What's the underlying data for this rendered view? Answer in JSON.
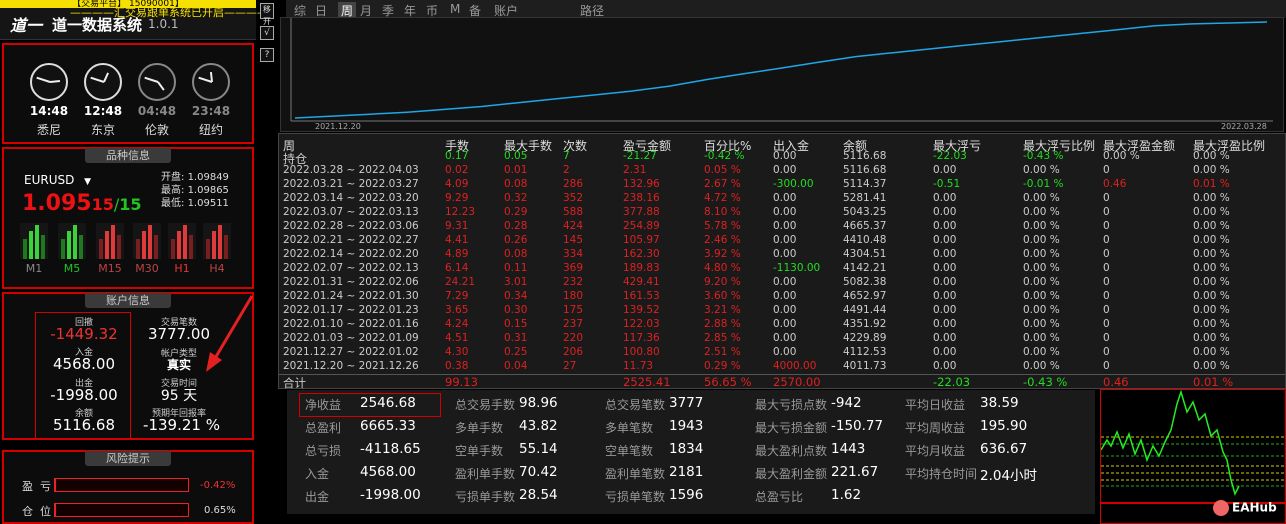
{
  "top_banner": "【交易平台】 15090001】",
  "marquee": "————汇交易跟单系统已开启————",
  "app": {
    "logo": "道一",
    "name": "道一数据系统",
    "version": "1.0.1"
  },
  "clocks": [
    {
      "time": "14:48",
      "name": "悉尼",
      "active": true
    },
    {
      "time": "12:48",
      "name": "东京",
      "active": true
    },
    {
      "time": "04:48",
      "name": "伦敦",
      "active": false
    },
    {
      "time": "23:48",
      "name": "纽约",
      "active": false
    }
  ],
  "symbol_panel": {
    "title": "品种信息",
    "symbol": "EURUSD",
    "price_main": "1.095",
    "price_mid": "15",
    "price_sep": "/",
    "price_last": "15",
    "open_label": "开盘:",
    "open": "1.09849",
    "high_label": "最高:",
    "high": "1.09865",
    "low_label": "最低:",
    "low": "1.09511",
    "timeframes": [
      "M1",
      "M5",
      "M15",
      "M30",
      "H1",
      "H4"
    ]
  },
  "account_panel": {
    "title": "账户信息",
    "drawdown_label": "回撤",
    "drawdown": "-1449.32",
    "deposit_label": "入金",
    "deposit": "4568.00",
    "withdraw_label": "出金",
    "withdraw": "-1998.00",
    "balance_label": "余额",
    "balance": "5116.68",
    "trades_label": "交易笔数",
    "trades": "3777.00",
    "acct_type_label": "帐户类型",
    "acct_type": "真实",
    "time_label": "交易时间",
    "time": "95 天",
    "yield_label": "预期年回报率",
    "yield": "-139.21 %"
  },
  "risk_panel": {
    "title": "风险提示",
    "profit_label": "盈  亏",
    "profit_value": "-0.42%",
    "position_label": "仓  位",
    "position_value": "0.65%"
  },
  "side_buttons": [
    "移开",
    "√",
    "?"
  ],
  "tabs": [
    "综",
    "日",
    "周",
    "月",
    "季",
    "年",
    "币",
    "M",
    "备",
    "账户",
    "路径"
  ],
  "active_tab": "周",
  "chart_data": {
    "type": "line",
    "x_start_label": "2021.12.20",
    "x_end_label": "2022.03.28",
    "color": "#1ea7e8",
    "values": [
      0.0,
      0.02,
      0.04,
      0.06,
      0.09,
      0.12,
      0.16,
      0.2,
      0.24,
      0.28,
      0.33,
      0.4,
      0.46,
      0.52,
      0.58,
      0.64,
      0.68,
      0.72,
      0.76,
      0.8,
      0.84,
      0.88,
      0.92,
      0.96,
      0.98,
      0.99,
      1.0
    ]
  },
  "table": {
    "headers": [
      "周",
      "手数",
      "最大手数",
      "次数",
      "盈亏金额",
      "百分比%",
      "出入金",
      "余额",
      "最大浮亏",
      "最大浮亏比例",
      "最大浮盈金额",
      "最大浮盈比例"
    ],
    "rows": [
      {
        "c": [
          "持仓",
          "0.17",
          "0.05",
          "7",
          "-21.27",
          "-0.42 %",
          "0.00",
          "5116.68",
          "-22.03",
          "-0.43 %",
          "0.00 %",
          "0.00 %"
        ],
        "cls": [
          "w",
          "g",
          "g",
          "g",
          "g",
          "g",
          "w",
          "w",
          "g",
          "g",
          "w",
          "w"
        ]
      },
      {
        "c": [
          "2022.03.28 ~ 2022.04.03",
          "0.02",
          "0.01",
          "2",
          "2.31",
          "0.05 %",
          "0.00",
          "5116.68",
          "0.00",
          "0.00 %",
          "0",
          "0.00 %"
        ],
        "cls": [
          "w",
          "r",
          "r",
          "r",
          "r",
          "r",
          "w",
          "w",
          "w",
          "w",
          "w",
          "w"
        ]
      },
      {
        "c": [
          "2022.03.21 ~ 2022.03.27",
          "4.09",
          "0.08",
          "286",
          "132.96",
          "2.67 %",
          "-300.00",
          "5114.37",
          "-0.51",
          "-0.01 %",
          "0.46",
          "0.01 %"
        ],
        "cls": [
          "w",
          "r",
          "r",
          "r",
          "r",
          "r",
          "g",
          "w",
          "g",
          "g",
          "r",
          "r"
        ]
      },
      {
        "c": [
          "2022.03.14 ~ 2022.03.20",
          "9.29",
          "0.32",
          "352",
          "238.16",
          "4.72 %",
          "0.00",
          "5281.41",
          "0.00",
          "0.00 %",
          "0",
          "0.00 %"
        ],
        "cls": [
          "w",
          "r",
          "r",
          "r",
          "r",
          "r",
          "w",
          "w",
          "w",
          "w",
          "w",
          "w"
        ]
      },
      {
        "c": [
          "2022.03.07 ~ 2022.03.13",
          "12.23",
          "0.29",
          "588",
          "377.88",
          "8.10 %",
          "0.00",
          "5043.25",
          "0.00",
          "0.00 %",
          "0",
          "0.00 %"
        ],
        "cls": [
          "w",
          "r",
          "r",
          "r",
          "r",
          "r",
          "w",
          "w",
          "w",
          "w",
          "w",
          "w"
        ]
      },
      {
        "c": [
          "2022.02.28 ~ 2022.03.06",
          "9.31",
          "0.28",
          "424",
          "254.89",
          "5.78 %",
          "0.00",
          "4665.37",
          "0.00",
          "0.00 %",
          "0",
          "0.00 %"
        ],
        "cls": [
          "w",
          "r",
          "r",
          "r",
          "r",
          "r",
          "w",
          "w",
          "w",
          "w",
          "w",
          "w"
        ]
      },
      {
        "c": [
          "2022.02.21 ~ 2022.02.27",
          "4.41",
          "0.26",
          "145",
          "105.97",
          "2.46 %",
          "0.00",
          "4410.48",
          "0.00",
          "0.00 %",
          "0",
          "0.00 %"
        ],
        "cls": [
          "w",
          "r",
          "r",
          "r",
          "r",
          "r",
          "w",
          "w",
          "w",
          "w",
          "w",
          "w"
        ]
      },
      {
        "c": [
          "2022.02.14 ~ 2022.02.20",
          "4.89",
          "0.08",
          "334",
          "162.30",
          "3.92 %",
          "0.00",
          "4304.51",
          "0.00",
          "0.00 %",
          "0",
          "0.00 %"
        ],
        "cls": [
          "w",
          "r",
          "r",
          "r",
          "r",
          "r",
          "w",
          "w",
          "w",
          "w",
          "w",
          "w"
        ]
      },
      {
        "c": [
          "2022.02.07 ~ 2022.02.13",
          "6.14",
          "0.11",
          "369",
          "189.83",
          "4.80 %",
          "-1130.00",
          "4142.21",
          "0.00",
          "0.00 %",
          "0",
          "0.00 %"
        ],
        "cls": [
          "w",
          "r",
          "r",
          "r",
          "r",
          "r",
          "g",
          "w",
          "w",
          "w",
          "w",
          "w"
        ]
      },
      {
        "c": [
          "2022.01.31 ~ 2022.02.06",
          "24.21",
          "3.01",
          "232",
          "429.41",
          "9.20 %",
          "0.00",
          "5082.38",
          "0.00",
          "0.00 %",
          "0",
          "0.00 %"
        ],
        "cls": [
          "w",
          "r",
          "r",
          "r",
          "r",
          "r",
          "w",
          "w",
          "w",
          "w",
          "w",
          "w"
        ]
      },
      {
        "c": [
          "2022.01.24 ~ 2022.01.30",
          "7.29",
          "0.34",
          "180",
          "161.53",
          "3.60 %",
          "0.00",
          "4652.97",
          "0.00",
          "0.00 %",
          "0",
          "0.00 %"
        ],
        "cls": [
          "w",
          "r",
          "r",
          "r",
          "r",
          "r",
          "w",
          "w",
          "w",
          "w",
          "w",
          "w"
        ]
      },
      {
        "c": [
          "2022.01.17 ~ 2022.01.23",
          "3.65",
          "0.30",
          "175",
          "139.52",
          "3.21 %",
          "0.00",
          "4491.44",
          "0.00",
          "0.00 %",
          "0",
          "0.00 %"
        ],
        "cls": [
          "w",
          "r",
          "r",
          "r",
          "r",
          "r",
          "w",
          "w",
          "w",
          "w",
          "w",
          "w"
        ]
      },
      {
        "c": [
          "2022.01.10 ~ 2022.01.16",
          "4.24",
          "0.15",
          "237",
          "122.03",
          "2.88 %",
          "0.00",
          "4351.92",
          "0.00",
          "0.00 %",
          "0",
          "0.00 %"
        ],
        "cls": [
          "w",
          "r",
          "r",
          "r",
          "r",
          "r",
          "w",
          "w",
          "w",
          "w",
          "w",
          "w"
        ]
      },
      {
        "c": [
          "2022.01.03 ~ 2022.01.09",
          "4.51",
          "0.31",
          "220",
          "117.36",
          "2.85 %",
          "0.00",
          "4229.89",
          "0.00",
          "0.00 %",
          "0",
          "0.00 %"
        ],
        "cls": [
          "w",
          "r",
          "r",
          "r",
          "r",
          "r",
          "w",
          "w",
          "w",
          "w",
          "w",
          "w"
        ]
      },
      {
        "c": [
          "2021.12.27 ~ 2022.01.02",
          "4.30",
          "0.25",
          "206",
          "100.80",
          "2.51 %",
          "0.00",
          "4112.53",
          "0.00",
          "0.00 %",
          "0",
          "0.00 %"
        ],
        "cls": [
          "w",
          "r",
          "r",
          "r",
          "r",
          "r",
          "w",
          "w",
          "w",
          "w",
          "w",
          "w"
        ]
      },
      {
        "c": [
          "2021.12.20 ~ 2021.12.26",
          "0.38",
          "0.04",
          "27",
          "11.73",
          "0.29 %",
          "4000.00",
          "4011.73",
          "0.00",
          "0.00 %",
          "0",
          "0.00 %"
        ],
        "cls": [
          "w",
          "r",
          "r",
          "r",
          "r",
          "r",
          "r",
          "w",
          "w",
          "w",
          "w",
          "w"
        ]
      }
    ],
    "total": {
      "c": [
        "合计",
        "99.13",
        "",
        "",
        "2525.41",
        "56.65 %",
        "2570.00",
        "",
        "-22.03",
        "-0.43 %",
        "0.46",
        "0.01 %"
      ],
      "cls": [
        "w",
        "r",
        "w",
        "w",
        "r",
        "r",
        "r",
        "w",
        "g",
        "g",
        "r",
        "r"
      ]
    }
  },
  "stats": {
    "col1": [
      [
        "净收益",
        "2546.68"
      ],
      [
        "总盈利",
        "6665.33"
      ],
      [
        "总亏损",
        "-4118.65"
      ],
      [
        "入金",
        "4568.00"
      ],
      [
        "出金",
        "-1998.00"
      ]
    ],
    "col2": [
      [
        "总交易手数",
        "98.96"
      ],
      [
        "多单手数",
        "43.82"
      ],
      [
        "空单手数",
        "55.14"
      ],
      [
        "盈利单手数",
        "70.42"
      ],
      [
        "亏损单手数",
        "28.54"
      ]
    ],
    "col3": [
      [
        "总交易笔数",
        "3777"
      ],
      [
        "多单笔数",
        "1943"
      ],
      [
        "空单笔数",
        "1834"
      ],
      [
        "盈利单笔数",
        "2181"
      ],
      [
        "亏损单笔数",
        "1596"
      ]
    ],
    "col4": [
      [
        "最大亏损点数",
        "-942"
      ],
      [
        "最大亏损金额",
        "-150.77"
      ],
      [
        "最大盈利点数",
        "1443"
      ],
      [
        "最大盈利金额",
        "221.67"
      ],
      [
        "总盈亏比",
        "1.62"
      ]
    ],
    "col5": [
      [
        "平均日收益",
        "38.59"
      ],
      [
        "平均周收益",
        "195.90"
      ],
      [
        "平均月收益",
        "636.67"
      ],
      [
        "平均持仓时间",
        "2.04小时"
      ]
    ]
  },
  "watermark": "EAHub"
}
